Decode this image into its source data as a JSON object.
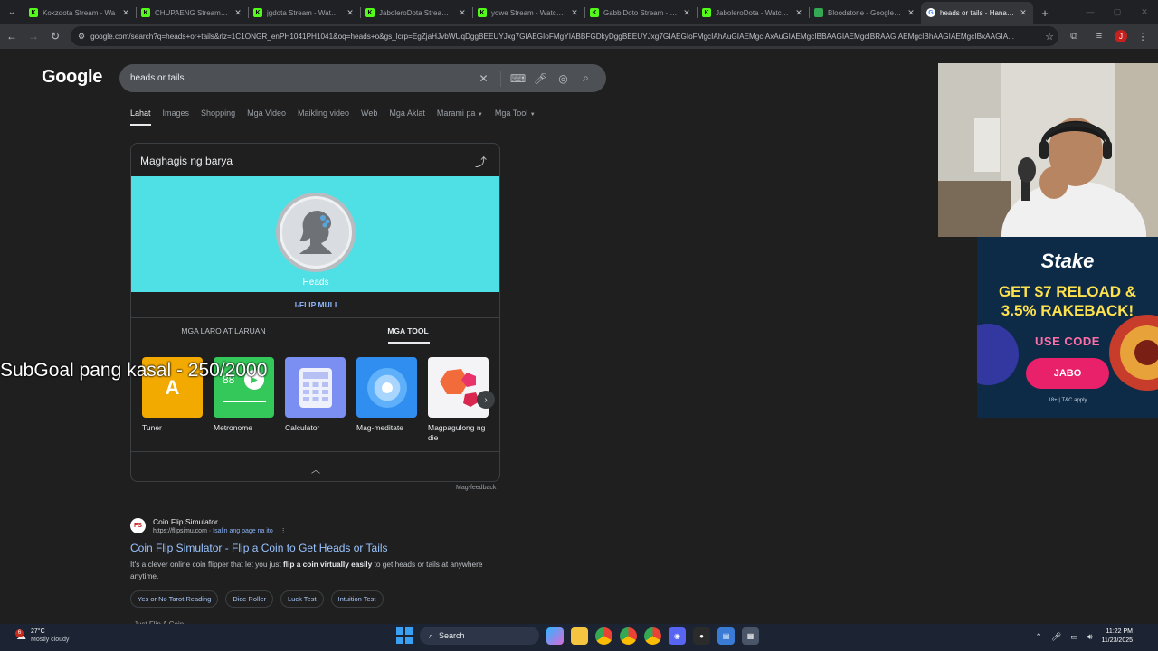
{
  "browser": {
    "tabs": [
      {
        "title": "Kokzdota Stream - Wa",
        "favicon": "kick-icon"
      },
      {
        "title": "CHUPAENG Stream - Wa",
        "favicon": "kick-icon"
      },
      {
        "title": "jgdota Stream - Watch L",
        "favicon": "kick-icon"
      },
      {
        "title": "JaboleroDota Stream - Y",
        "favicon": "kick-icon"
      },
      {
        "title": "yowe Stream - Watch Li",
        "favicon": "kick-icon"
      },
      {
        "title": "GabbiDoto Stream - Wa",
        "favicon": "kick-icon"
      },
      {
        "title": "JaboleroDota - Watch th",
        "favicon": "kick-icon"
      },
      {
        "title": "Bloodstone - Google Sh",
        "favicon": "sheets-icon"
      },
      {
        "title": "heads or tails - Hanapin",
        "favicon": "google-icon",
        "active": true
      }
    ],
    "url": "google.com/search?q=heads+or+tails&rlz=1C1ONGR_enPH1041PH1041&oq=heads+o&gs_lcrp=EgZjaHJvbWUqDggBEEUYJxg7GIAEGIoFMgYIABBFGDkyDggBEEUYJxg7GIAEGIoFMgcIAhAuGIAEMgcIAxAuGIAEMgcIBBAAGIAEMgcIBRAAGIAEMgcIBhAAGIAEMgcIBxAAGIA...",
    "profile_initial": "J"
  },
  "google": {
    "logo": "Google",
    "query": "heads or tails",
    "tabs": [
      "Lahat",
      "Images",
      "Shopping",
      "Mga Video",
      "Maikling video",
      "Web",
      "Mga Aklat",
      "Marami pa",
      "Mga Tool"
    ],
    "card": {
      "title": "Maghagis ng barya",
      "result": "Heads",
      "flip_again": "I-FLIP MULI",
      "section_tabs": [
        "MGA LARO AT LARUAN",
        "MGA TOOL"
      ],
      "tools": [
        {
          "label": "Tuner",
          "tile": "A"
        },
        {
          "label": "Metronome",
          "tile": "88"
        },
        {
          "label": "Calculator"
        },
        {
          "label": "Mag-meditate"
        },
        {
          "label": "Magpagulong ng die"
        }
      ]
    },
    "feedback": "Mag-feedback",
    "result": {
      "site_name": "Coin Flip Simulator",
      "site_url": "https://flipsimu.com",
      "translate": "Isalin ang page na ito",
      "title": "Coin Flip Simulator - Flip a Coin to Get Heads or Tails",
      "snippet_pre": "It's a clever online coin flipper that let you just ",
      "snippet_bold": "flip a coin virtually easily",
      "snippet_post": " to get heads or tails at anywhere anytime.",
      "chips": [
        "Yes or No Tarot Reading",
        "Dice Roller",
        "Luck Test",
        "Intuition Test"
      ]
    },
    "next_result": "Just Flip A Coin"
  },
  "overlay": {
    "subgoal": "SubGoal pang kasal - 250/2000",
    "ad": {
      "brand": "Stake",
      "headline_1": "GET $7 RELOAD &",
      "headline_2": "3.5% RAKEBACK!",
      "code_label": "USE CODE",
      "code": "JABO",
      "fine_print": "18+ | T&C apply"
    }
  },
  "taskbar": {
    "weather_temp": "27°C",
    "weather_desc": "Mostly cloudy",
    "weather_badge": "6",
    "search_label": "Search",
    "time": "11:22 PM",
    "date": "11/23/2025"
  },
  "colors": {
    "coin_panel": "#4ee0e4",
    "link": "#99c3ff",
    "ad_accent": "#e8216a"
  }
}
